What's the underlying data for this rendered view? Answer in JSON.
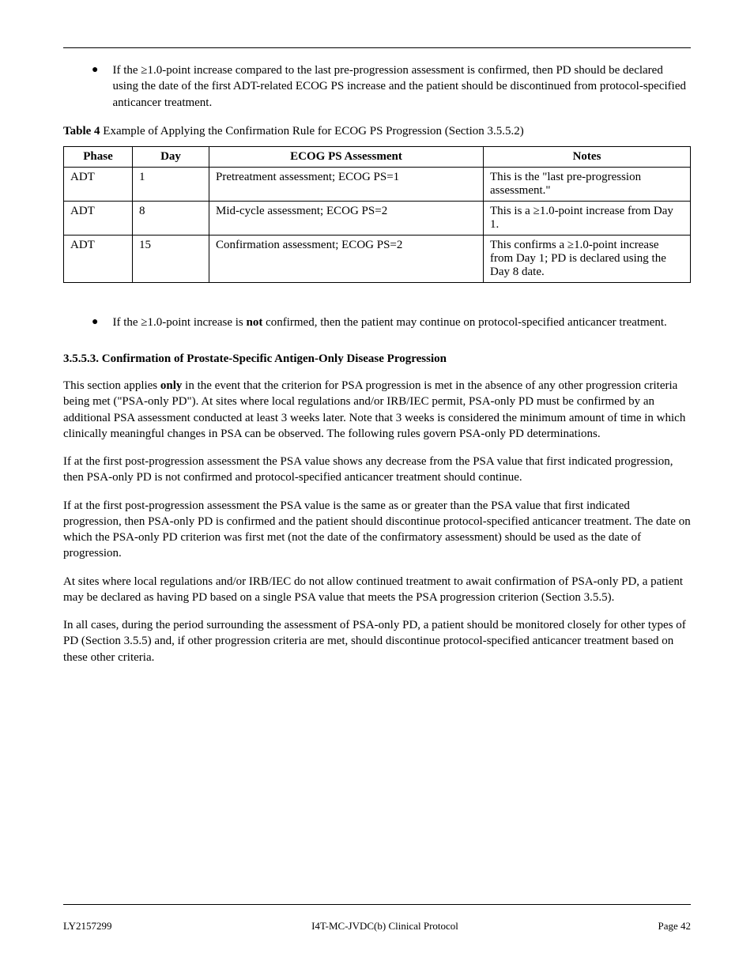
{
  "bullet1": "If the ≥1.0-point increase compared to the last pre-progression assessment is confirmed, then PD should be declared using the date of the first ADT-related ECOG PS increase and the patient should be discontinued from protocol-specified anticancer treatment.",
  "table_caption_label": "Table 4",
  "table_caption_text": "Example of Applying the Confirmation Rule for ECOG PS Progression (Section 3.5.5.2)",
  "table": {
    "headers": [
      "Phase",
      "Day",
      "ECOG PS Assessment",
      "Notes"
    ],
    "rows": [
      {
        "phase": "ADT",
        "day": "1",
        "assess": "Pretreatment assessment; ECOG PS=1",
        "notes": "This is the \"last pre-progression assessment.\""
      },
      {
        "phase": "ADT",
        "day": "8",
        "assess": "Mid-cycle assessment; ECOG PS=2",
        "notes": "This is a ≥1.0-point increase from Day 1."
      },
      {
        "phase": "ADT",
        "day": "15",
        "assess": "Confirmation assessment; ECOG PS=2",
        "notes": "This confirms a ≥1.0-point increase from Day 1; PD is declared using the Day 8 date."
      }
    ]
  },
  "bullet2_lead": "If the ≥1.0-point increase is ",
  "bullet2_signal": "not",
  "bullet2_tail": " confirmed, then the patient may continue on protocol-specified anticancer treatment.",
  "section_heading": "3.5.5.3. Confirmation of Prostate-Specific Antigen-Only Disease Progression",
  "para1_pre": "This section applies ",
  "para1_sig": "only",
  "para1_post": " in the event that the criterion for PSA progression is met in the absence of any other progression criteria being met (\"PSA-only PD\"). At sites where local regulations and/or IRB/IEC permit, PSA-only PD must be confirmed by an additional PSA assessment conducted at least 3 weeks later. Note that 3 weeks is considered the minimum amount of time in which clinically meaningful changes in PSA can be observed. The following rules govern PSA-only PD determinations.",
  "para2": "If at the first post-progression assessment the PSA value shows any decrease from the PSA value that first indicated progression, then PSA-only PD is not confirmed and protocol-specified anticancer treatment should continue.",
  "para3": "If at the first post-progression assessment the PSA value is the same as or greater than the PSA value that first indicated progression, then PSA-only PD is confirmed and the patient should discontinue protocol-specified anticancer treatment. The date on which the PSA-only PD criterion was first met (not the date of the confirmatory assessment) should be used as the date of progression.",
  "para4": "At sites where local regulations and/or IRB/IEC do not allow continued treatment to await confirmation of PSA-only PD, a patient may be declared as having PD based on a single PSA value that meets the PSA progression criterion (Section 3.5.5).",
  "para5": "In all cases, during the period surrounding the assessment of PSA-only PD, a patient should be monitored closely for other types of PD (Section 3.5.5) and, if other progression criteria are met, should discontinue protocol-specified anticancer treatment based on these other criteria.",
  "footer_left": "LY2157299",
  "footer_right": "I4T-MC-JVDC(b) Clinical Protocol",
  "footer_page": "Page 42"
}
